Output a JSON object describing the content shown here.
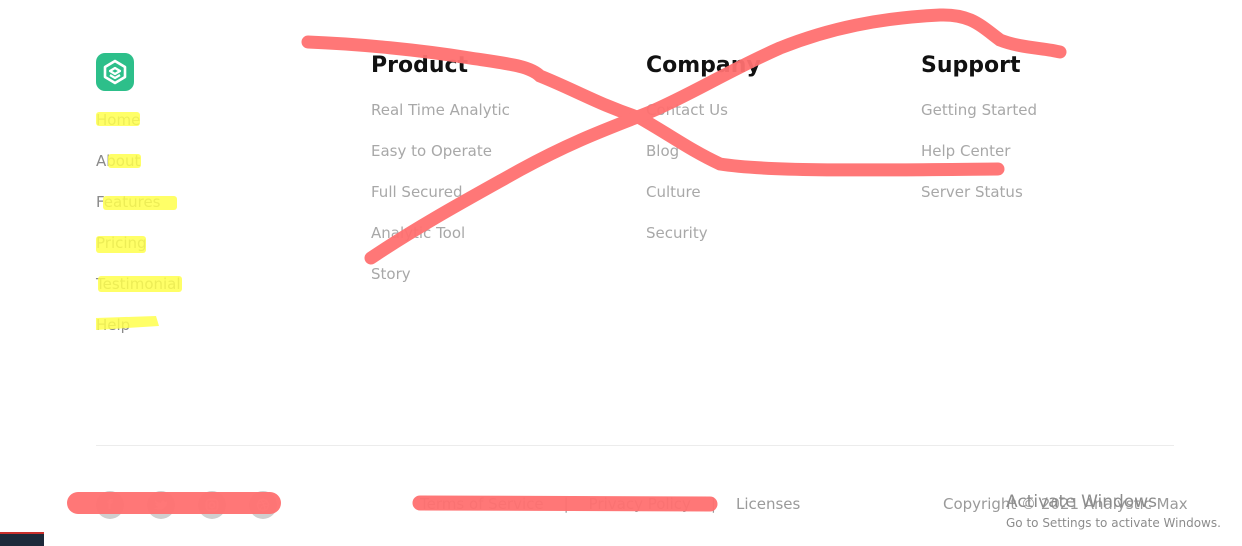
{
  "brand": {
    "logo_icon": "hexagon-logo-icon",
    "color": "#2dbf8a"
  },
  "nav": {
    "items": [
      {
        "label": "Home"
      },
      {
        "label": "About"
      },
      {
        "label": "Features"
      },
      {
        "label": "Pricing"
      },
      {
        "label": "Testimonial"
      },
      {
        "label": "Help"
      }
    ]
  },
  "columns": {
    "product": {
      "title": "Product",
      "links": [
        "Real Time Analytic",
        "Easy to Operate",
        "Full Secured",
        "Analytic Tool",
        "Story"
      ]
    },
    "company": {
      "title": "Company",
      "links": [
        "Contact Us",
        "Blog",
        "Culture",
        "Security"
      ]
    },
    "support": {
      "title": "Support",
      "links": [
        "Getting Started",
        "Help Center",
        "Server Status"
      ]
    }
  },
  "footer": {
    "social": [
      "facebook-icon",
      "twitter-icon",
      "instagram-icon",
      "dribbble-icon"
    ],
    "legal": {
      "terms": "Terms of Service",
      "separator": "|",
      "privacy": "Privacy Policy",
      "licenses": "Licenses"
    },
    "copyright": "Copyright © 2021 Analystic Max"
  },
  "os_watermark": {
    "title": "Activate Windows",
    "subtitle": "Go to Settings to activate Windows."
  },
  "annotations": {
    "highlight_color": "#ffff4d",
    "strike_color": "#ff7070"
  }
}
